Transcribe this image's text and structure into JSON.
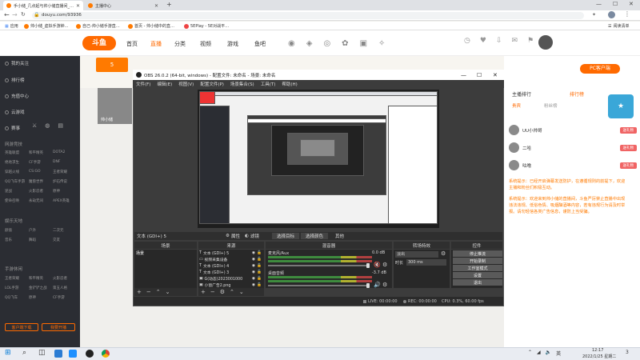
{
  "browser": {
    "tabs": [
      {
        "label": "手小储_几点起与帅小储直播间_…",
        "active": true
      },
      {
        "label": "主播中心",
        "active": false
      }
    ],
    "new_tab": "+",
    "url": "douyu.com/93936",
    "bookmarks": [
      "应用",
      "帅小储_虚拟手游钟…",
      "自己-帅小储手游直…",
      "首页 - 帅小储中的直…",
      "5EPlay - 5E对战平…"
    ],
    "reading_list": "阅读清单"
  },
  "douyu": {
    "logo": "斗鱼",
    "nav": [
      "首页",
      "直播",
      "分类",
      "视频",
      "游戏",
      "鱼吧"
    ],
    "level_badge": "5",
    "streamer_label": "帅小储",
    "sidebar": {
      "items": [
        "我的关注",
        "排行榜",
        "充值中心",
        "云游戏",
        "赛事"
      ],
      "section1": "网游竞技",
      "grid1": [
        "英雄联盟",
        "和平精英",
        "DOTA2",
        "绝地求生",
        "CF手游",
        "DNF",
        "穿越火线",
        "CS:GO",
        "王者荣耀",
        "QQ飞车手游",
        "魔兽世界",
        "炉石传说",
        "逆战",
        "火影忍者",
        "原神",
        "使命召唤",
        "永劫无间",
        "APEX英雄"
      ],
      "section2": "娱乐天地",
      "grid2": [
        "颜值",
        "户外",
        "二次元",
        "音乐",
        "舞蹈",
        "交友"
      ],
      "section3": "手游休闲",
      "grid3": [
        "王者荣耀",
        "和平精英",
        "火影忍者",
        "LOL手游",
        "金铲铲之战",
        "第五人格",
        "QQ飞车",
        "原神",
        "CF手游"
      ],
      "btn_live": "客户端下载",
      "btn_play": "我要开播"
    },
    "right": {
      "pc_client": "PC客户端",
      "tabs": [
        "贵宾",
        "粉丝榜"
      ],
      "rank_title": "主播排行",
      "rank_tag": "排行榜",
      "fans": [
        {
          "name": "UU小帅哥",
          "tag": "送礼物"
        },
        {
          "name": "二哈",
          "tag": "送礼物"
        },
        {
          "name": "咕噜",
          "tag": "送礼物"
        }
      ],
      "sys1": "系统提示：已经开启弹幕发送防护，在遵循规则的前提下，欢迎主播和粉丝们积极互动。",
      "sys2": "系统提示：欢迎来到帅小储的直播间，斗鱼严厉禁止直播中出现违法违规、低俗色情、吸烟酗酒等内容，若有违规行为请及时举报。请勿轻信各类广告信息，谨防上当受骗。"
    }
  },
  "obs": {
    "title": "OBS 26.0.2 (64-bit, windows) - 配置文件: 未命名 - 场景: 未命名",
    "menu": [
      "文件(F)",
      "编辑(E)",
      "视图(V)",
      "配置文件(P)",
      "场景集合(S)",
      "工具(T)",
      "帮助(H)"
    ],
    "source_label": "文本 (GDI+) 5",
    "prop_buttons": [
      "属性",
      "滤镜"
    ],
    "transitions": [
      "选择目标",
      "选择颜色",
      "其他"
    ],
    "panels": {
      "scenes": "场景",
      "sources": "来源",
      "mixer": "混音器",
      "transitions": "转场特效",
      "controls": "控件"
    },
    "scene_item": "场景",
    "sources": [
      "文本 (GDI+) 5",
      "视频采集设备",
      "文本 (GDI+) 4",
      "文本 (GDI+) 3",
      "G(动态)2023001000",
      "小窗广告2.png"
    ],
    "mixer": [
      {
        "name": "麦克风/Aux",
        "db": "0.0 dB"
      },
      {
        "name": "桌面音频",
        "db": "-3.7 dB"
      }
    ],
    "fade_label": "淡出",
    "duration_label": "时长",
    "duration_value": "300 ms",
    "controls": [
      "停止推流",
      "开始录制",
      "工作室模式",
      "设置",
      "退出"
    ],
    "status": {
      "live": "LIVE: 00:00:00",
      "rec": "REC: 00:00:00",
      "cpu": "CPU: 0.3%, 60.00 fps"
    }
  },
  "taskbar": {
    "time": "12:17",
    "date": "2022/1/25 星期二",
    "lang": "英",
    "notif": "3"
  }
}
